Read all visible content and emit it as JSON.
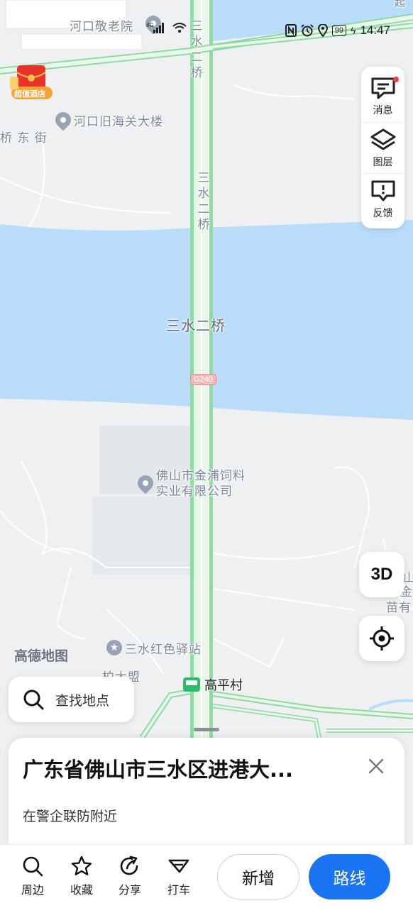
{
  "status_bar": {
    "time": "14:47",
    "battery": "99"
  },
  "map": {
    "labels": {
      "hekou_nursing_home": "河口敬老院",
      "hekou_old_customs": "河口旧海关大楼",
      "bridge_east_street": "桥 东 街",
      "sanshui_bridge_top": "三水二桥",
      "sanshui_bridge_mid": "三水二桥",
      "sanshui_bridge_river": "三水二桥",
      "road_number": "G240",
      "feed_company_line1": "佛山市金浦饲料",
      "feed_company_line2": "实业有限公司",
      "red_post": "三水红色驿站",
      "partial_left": "柏大盟",
      "partial_right_1": "山",
      "partial_right_2": "金",
      "partial_right_3": "苗有",
      "corner_partial": "起"
    },
    "hotel_badge": "超值酒店",
    "bus_stop": "高平村",
    "logo": "高德地图"
  },
  "side_panel": {
    "messages": "消息",
    "layers": "图层",
    "feedback": "反馈"
  },
  "controls": {
    "three_d": "3D"
  },
  "search": {
    "placeholder": "查找地点"
  },
  "sheet": {
    "title": "广东省佛山市三水区进港大...",
    "subtitle": "在警企联防附近"
  },
  "actions": {
    "nearby": "周边",
    "favorite": "收藏",
    "share": "分享",
    "taxi": "打车",
    "new": "新增",
    "route": "路线"
  },
  "colors": {
    "water": "#b9dcfb",
    "land": "#eef0f2",
    "road_fill": "#e4f5e7",
    "road_edge": "#8fd9a3",
    "primary": "#1a73f0"
  }
}
